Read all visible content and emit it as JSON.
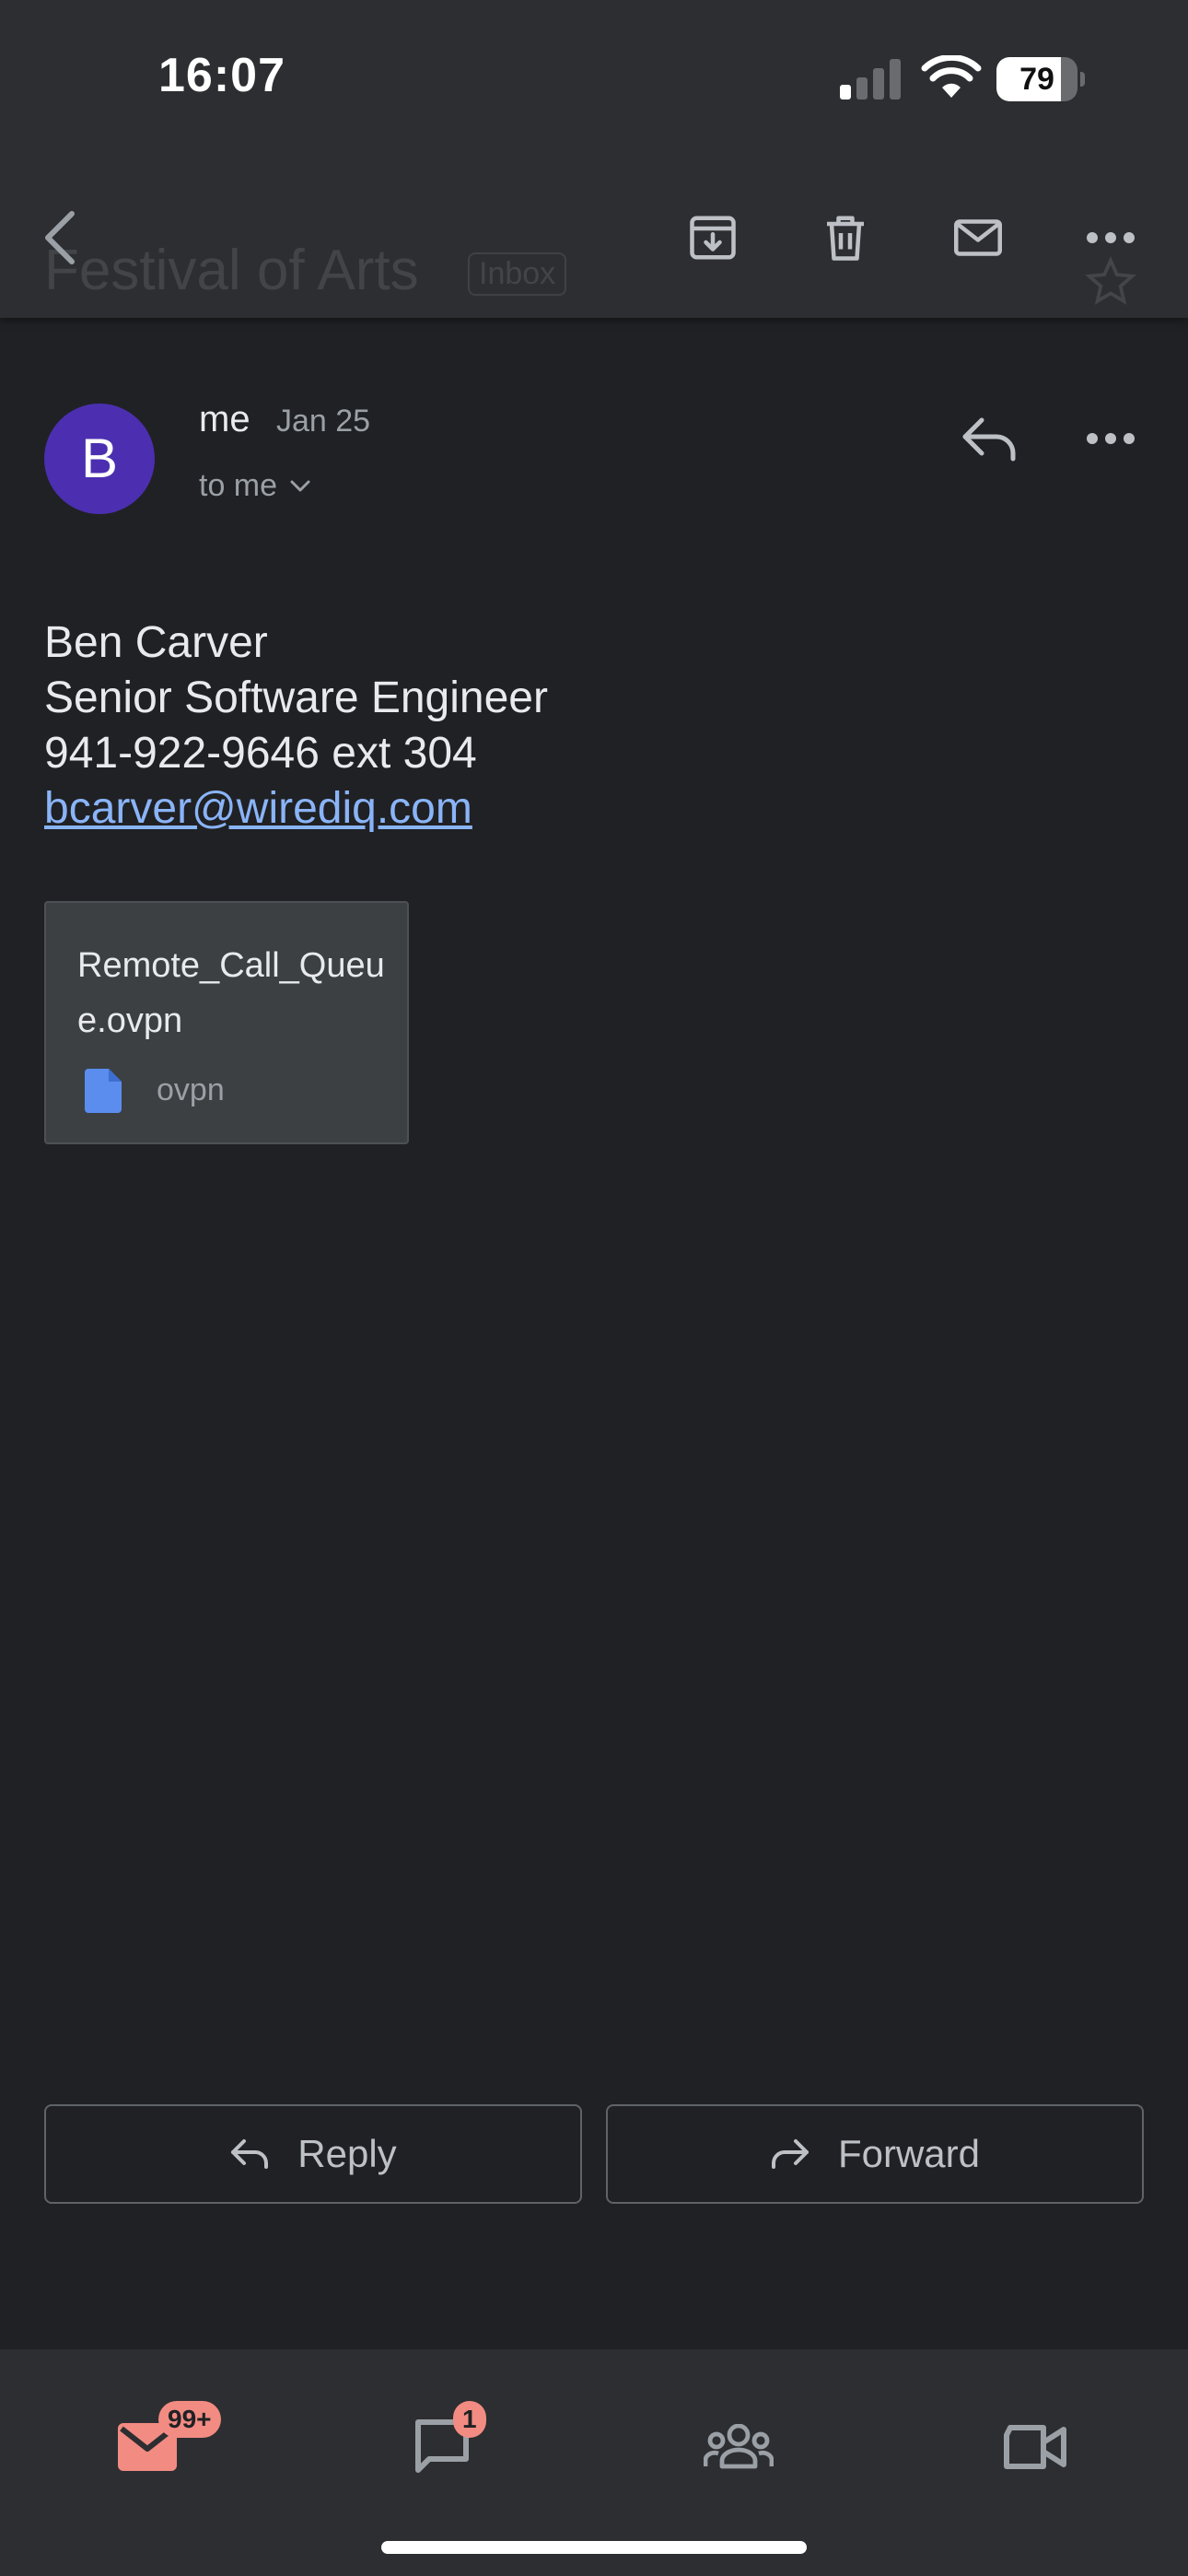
{
  "status_bar": {
    "time": "16:07",
    "battery_level": "79"
  },
  "toolbar": {
    "subject": "Festival of Arts",
    "label": "Inbox",
    "icons": [
      "back-icon",
      "archive-icon",
      "trash-icon",
      "mail-icon",
      "more-icon"
    ]
  },
  "message": {
    "avatar_letter": "B",
    "sender": "me",
    "date": "Jan 25",
    "recipient": "to me",
    "body_lines": [
      "Ben Carver",
      "Senior Software Engineer",
      "941-922-9646 ext 304"
    ],
    "email_link": "bcarver@wirediq.com",
    "attachment": {
      "name": "Remote_Call_Queue.ovpn",
      "type": "ovpn"
    }
  },
  "actions": {
    "reply_label": "Reply",
    "forward_label": "Forward"
  },
  "bottom_nav": {
    "mail_badge": "99+",
    "chat_badge": "1",
    "items": [
      "mail-icon",
      "chat-icon",
      "spaces-icon",
      "meet-icon"
    ]
  },
  "colors": {
    "background": "#202124",
    "chrome": "#2d2e31",
    "avatar": "#4b2fb0",
    "link": "#8ab4f8",
    "badge": "#f28b82"
  }
}
